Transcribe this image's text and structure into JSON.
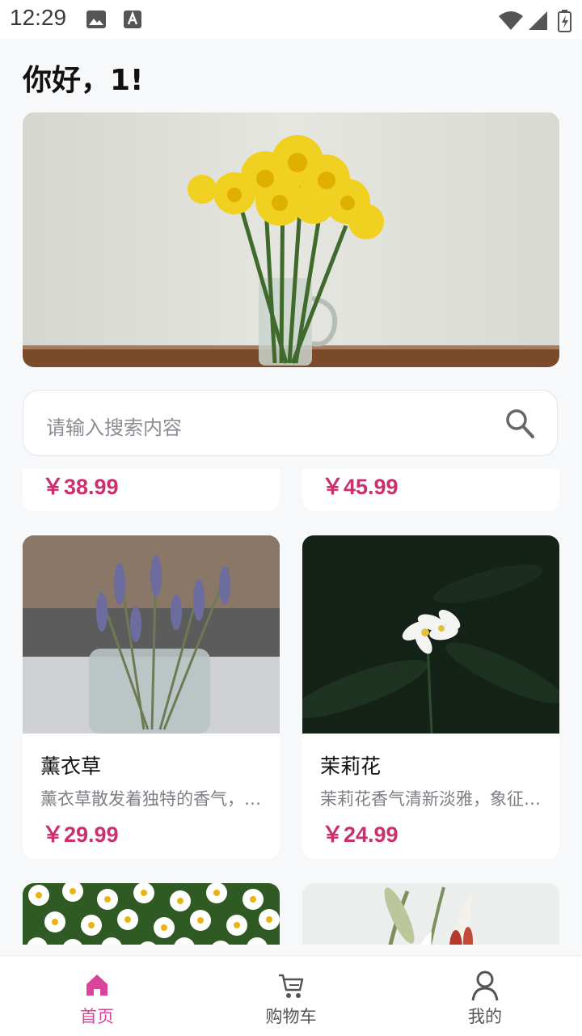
{
  "status_bar": {
    "time": "12:29"
  },
  "greeting": "你好，1!",
  "search": {
    "placeholder": "请输入搜索内容"
  },
  "products_partial": [
    {
      "price": "￥38.99"
    },
    {
      "price": "￥45.99"
    }
  ],
  "products": [
    {
      "name": "薰衣草",
      "desc": "薰衣草散发着独特的香气，…",
      "price": "￥29.99"
    },
    {
      "name": "茉莉花",
      "desc": "茉莉花香气清新淡雅，象征…",
      "price": "￥24.99"
    }
  ],
  "tabbar": {
    "items": [
      {
        "label": "首页",
        "icon": "home-icon"
      },
      {
        "label": "购物车",
        "icon": "cart-icon"
      },
      {
        "label": "我的",
        "icon": "user-icon"
      }
    ]
  },
  "colors": {
    "accent": "#d9459a",
    "price": "#cc2f6e"
  }
}
